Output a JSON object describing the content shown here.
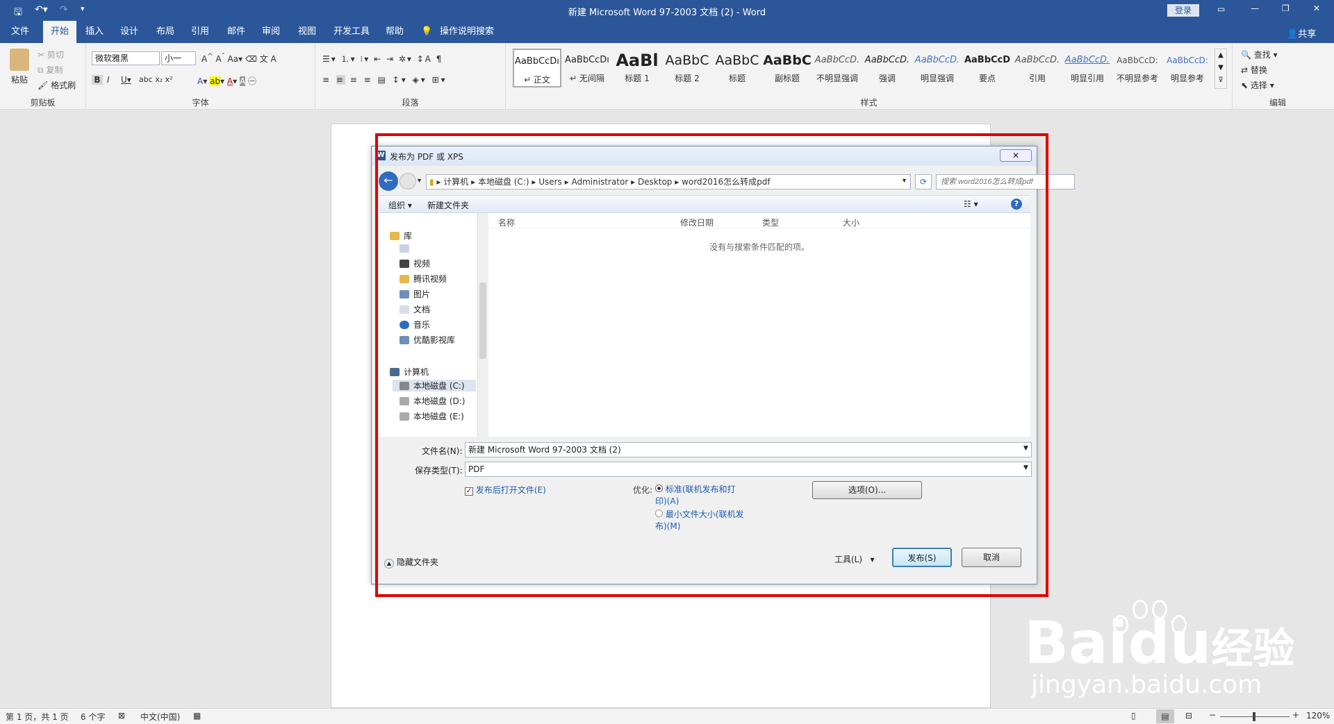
{
  "titlebar": {
    "title": "新建 Microsoft Word 97-2003 文档 (2)  -  Word",
    "login": "登录"
  },
  "tabs": [
    "文件",
    "开始",
    "插入",
    "设计",
    "布局",
    "引用",
    "邮件",
    "审阅",
    "视图",
    "开发工具",
    "帮助"
  ],
  "active_tab": "开始",
  "tell_me": "操作说明搜索",
  "share": "共享",
  "clipboard": {
    "paste": "粘贴",
    "cut": "剪切",
    "copy": "复制",
    "format_painter": "格式刷",
    "label": "剪贴板"
  },
  "font": {
    "name": "微软雅黑",
    "size": "小一",
    "label": "字体"
  },
  "paragraph": {
    "label": "段落"
  },
  "styles": {
    "label": "样式",
    "items": [
      {
        "sample": "AaBbCcDı",
        "name": "↵ 正文"
      },
      {
        "sample": "AaBbCcDı",
        "name": "↵ 无间隔"
      },
      {
        "sample": "AaBl",
        "name": "标题 1"
      },
      {
        "sample": "AaBbC",
        "name": "标题 2"
      },
      {
        "sample": "AaBbC",
        "name": "标题"
      },
      {
        "sample": "AaBbC",
        "name": "副标题"
      },
      {
        "sample": "AaBbCcD.",
        "name": "不明显强调"
      },
      {
        "sample": "AaBbCcD.",
        "name": "强调"
      },
      {
        "sample": "AaBbCcD.",
        "name": "明显强调"
      },
      {
        "sample": "AaBbCcD",
        "name": "要点"
      },
      {
        "sample": "AaBbCcD.",
        "name": "引用"
      },
      {
        "sample": "AaBbCcD.",
        "name": "明显引用"
      },
      {
        "sample": "AaBbCcD:",
        "name": "不明显参考"
      },
      {
        "sample": "AaBbCcD:",
        "name": "明显参考"
      }
    ]
  },
  "editing": {
    "find": "查找",
    "replace": "替换",
    "select": "选择",
    "label": "编辑"
  },
  "dialog": {
    "title": "发布为 PDF 或 XPS",
    "breadcrumb": [
      "计算机",
      "本地磁盘 (C:)",
      "Users",
      "Administrator",
      "Desktop",
      "word2016怎么转成pdf"
    ],
    "search_placeholder": "搜索 word2016怎么转成pdf",
    "organize": "组织",
    "new_folder": "新建文件夹",
    "nav": {
      "libraries": "库",
      "lib_items": [
        "视频",
        "腾讯视频",
        "图片",
        "文档",
        "音乐",
        "优酷影视库"
      ],
      "computer": "计算机",
      "drives": [
        "本地磁盘 (C:)",
        "本地磁盘 (D:)",
        "本地磁盘 (E:)"
      ]
    },
    "columns": [
      "名称",
      "修改日期",
      "类型",
      "大小"
    ],
    "empty_message": "没有与搜索条件匹配的项。",
    "filename_label": "文件名(N):",
    "filename_value": "新建 Microsoft Word 97-2003 文档 (2)",
    "filetype_label": "保存类型(T):",
    "filetype_value": "PDF",
    "open_after": "发布后打开文件(E)",
    "optimize_label": "优化:",
    "opt_standard": "标准(联机发布和打印)(A)",
    "opt_minimum": "最小文件大小(联机发布)(M)",
    "options_btn": "选项(O)...",
    "hide_folders": "隐藏文件夹",
    "tools": "工具(L)",
    "publish": "发布(S)",
    "cancel": "取消"
  },
  "status": {
    "page": "第 1 页，共 1 页",
    "words": "6 个字",
    "language": "中文(中国)",
    "zoom": "120%"
  },
  "watermark": {
    "brand": "Bai",
    "brand2": "du",
    "cn": "经验",
    "url": "jingyan.baidu.com"
  }
}
